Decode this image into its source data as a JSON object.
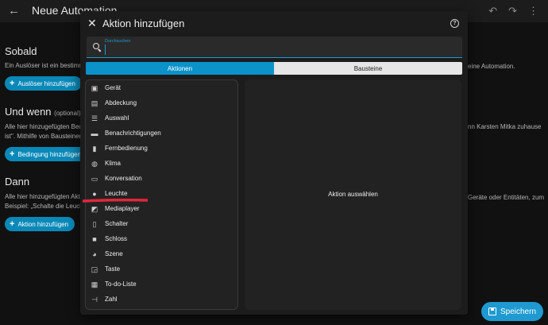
{
  "topbar": {
    "back_glyph": "←",
    "title": "Neue Automation"
  },
  "sections": {
    "sobald": {
      "heading": "Sobald",
      "text": "Ein Auslöser ist ein bestimm",
      "button": "Auslöser hinzufügen",
      "right_text": "eine Automation."
    },
    "und_wenn": {
      "heading": "Und wenn",
      "optional": "(optional)",
      "text1": "Alle hier hinzugefügten Bedi",
      "text2": "ist\". Mithilfe von Bausteinen",
      "button": "Bedingung hinzufügen",
      "right_text": "nn Karsten Mitka zuhause"
    },
    "dann": {
      "heading": "Dann",
      "text1": "Alle hier hinzugefügten Akti",
      "text2": "Beispiel: „Schalte die Leuch",
      "button": "Aktion hinzufügen",
      "right_text": "Geräte oder Entitäten, zum"
    }
  },
  "save_label": "Speichern",
  "dialog": {
    "title": "Aktion hinzufügen",
    "close_glyph": "✕",
    "help_glyph": "?",
    "search": {
      "label": "Durchsuchen",
      "value": ""
    },
    "tabs": [
      {
        "label": "Aktionen",
        "active": true
      },
      {
        "label": "Bausteine",
        "active": false
      }
    ],
    "items": [
      {
        "label": "Gerät",
        "icon": "device-icon"
      },
      {
        "label": "Abdeckung",
        "icon": "cover-icon"
      },
      {
        "label": "Auswahl",
        "icon": "list-icon"
      },
      {
        "label": "Benachrichtigungen",
        "icon": "message-icon"
      },
      {
        "label": "Fernbedienung",
        "icon": "remote-icon"
      },
      {
        "label": "Klima",
        "icon": "thermostat-icon"
      },
      {
        "label": "Konversation",
        "icon": "conversation-icon"
      },
      {
        "label": "Leuchte",
        "icon": "lightbulb-icon"
      },
      {
        "label": "Mediaplayer",
        "icon": "cast-icon"
      },
      {
        "label": "Schalter",
        "icon": "switch-icon"
      },
      {
        "label": "Schloss",
        "icon": "lock-icon"
      },
      {
        "label": "Szene",
        "icon": "palette-icon"
      },
      {
        "label": "Taste",
        "icon": "button-icon"
      },
      {
        "label": "To-do-Liste",
        "icon": "todo-icon"
      },
      {
        "label": "Zahl",
        "icon": "number-icon"
      }
    ],
    "detail_placeholder": "Aktion auswählen"
  },
  "colors": {
    "accent": "#0b92c9",
    "highlight": "#e0283a"
  }
}
